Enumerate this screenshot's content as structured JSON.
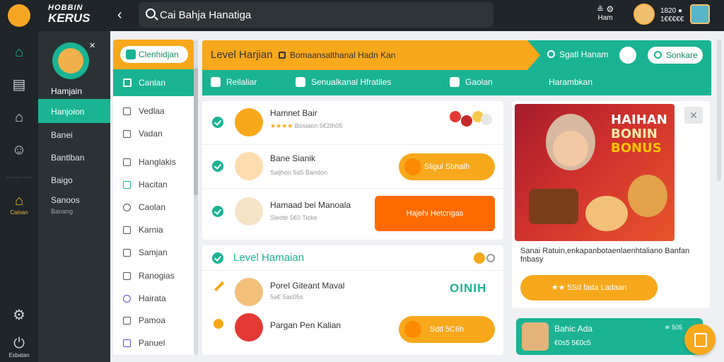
{
  "app": {
    "brand_top": "HOBBIN",
    "brand_main": "KERUS"
  },
  "search": {
    "value": "Cai Bahja Hanatiga"
  },
  "top_user": {
    "icons": "≗ ⚙",
    "label": "Ham"
  },
  "top_info": {
    "line1": "1820 ●",
    "line2": "1€€€€€"
  },
  "rail": {
    "items": [
      "home-icon",
      "document-icon",
      "building-icon",
      "user-icon",
      "gold-badge-icon",
      "settings-icon",
      "power-icon"
    ],
    "gold_label": "Cainan",
    "bottom_label": "Esbatan"
  },
  "side2": {
    "profile_name": "Hamjain",
    "close": "✕",
    "active": "Hanjoion",
    "items": [
      "Banei",
      "Bantlban",
      "Baigo",
      "Sanoos"
    ],
    "small": "Banang"
  },
  "navcard": {
    "pill_label": "Clenhidjan",
    "active_label": "Canlan",
    "items": [
      "Vedlaa",
      "Vadan",
      "Hanglakis",
      "Hacitan",
      "Caolan",
      "Karnia",
      "Samjan",
      "Ranogias",
      "Hairata",
      "Pamoa",
      "Panuel"
    ]
  },
  "header": {
    "title": "Level Harjian",
    "subtitle": "Bomaansalthanal Hadn Kan",
    "search_label": "Sgatl Hanam",
    "button_label": "Sonkare"
  },
  "tabs": [
    "Reilaliar",
    "Senualkanal Hfratiles",
    "Gaolan",
    "Harambkan"
  ],
  "tasks": [
    {
      "name": "Hamnet Bair",
      "meta": "Bosiaon 5€2th05",
      "stars": "★★★★",
      "button": ""
    },
    {
      "name": "Bane Sianik",
      "meta": "Saljhon 5a5 Bandon",
      "stars": "",
      "button": "Sligul Sbhalh"
    },
    {
      "name": "Hamaad bei Manoala",
      "meta": "Sleotir 5€0 Ticke",
      "stars": "",
      "button": "Hajehi Hetcngas"
    }
  ],
  "level_section": {
    "title": "Level Hamaian",
    "rows": [
      {
        "name": "Porel Giteant Maval",
        "meta": "5a€ 5ac05s",
        "badge": "OINIH"
      },
      {
        "name": "Pargan Pen Kalian",
        "meta": "",
        "button": "Sdtl 5C6h"
      }
    ]
  },
  "promo": {
    "title_line1": "HAIHAN",
    "title_line2": "BONIN",
    "title_line3": "BONUS",
    "close": "✕",
    "desc": "Sanai Ratuin,enkapanbotaenlaenhtaliano Banfan fnbasy",
    "button": "★★ 5Sd fada Ladaan"
  },
  "mini_card": {
    "name": "Bahic Ada",
    "sub": "€0s5 5€0c5",
    "right": "≐ 505"
  },
  "colors": {
    "accent": "#1ab394",
    "orange": "#f7a81b",
    "dark": "#1f2528"
  }
}
